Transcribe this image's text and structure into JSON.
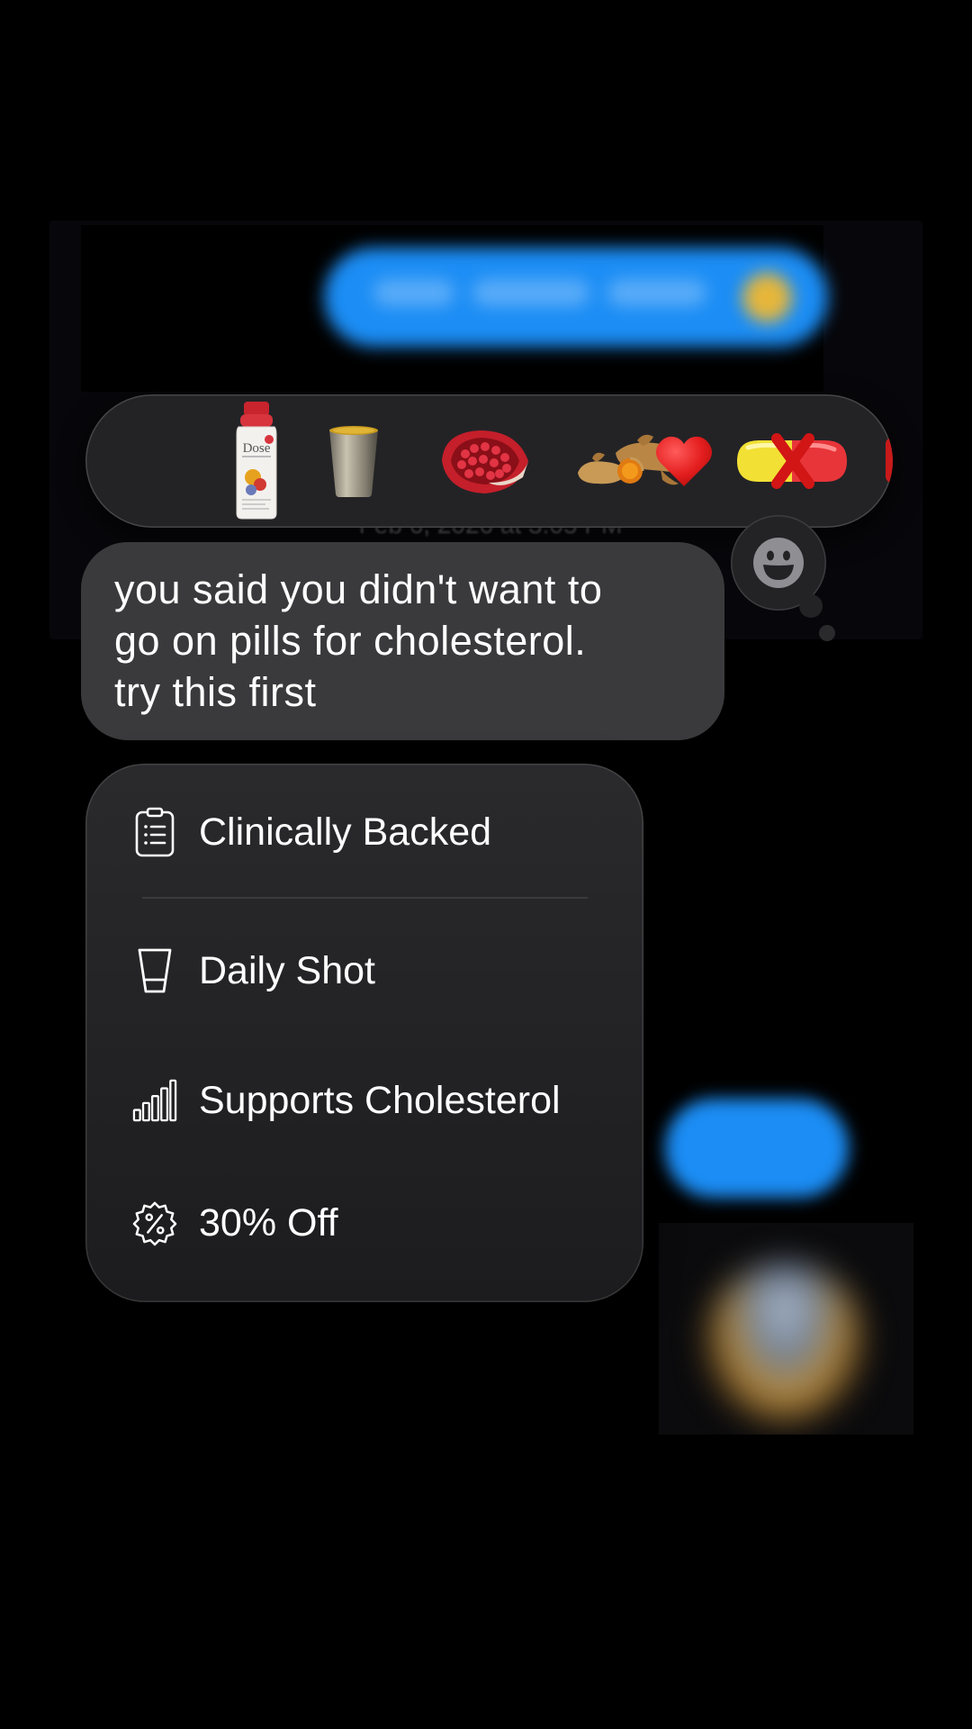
{
  "timestamp": "Feb 6, 2026 at 3:05 PM",
  "reactions": [
    {
      "name": "dose-bottle-icon",
      "brand": "Dose"
    },
    {
      "name": "shot-cup-icon"
    },
    {
      "name": "pomegranate-icon"
    },
    {
      "name": "turmeric-icon"
    },
    {
      "name": "red-heart-icon"
    },
    {
      "name": "crossed-pill-icon"
    }
  ],
  "message": {
    "text": "you said you didn't want to\ngo on pills for cholesterol.\ntry this first"
  },
  "features": [
    {
      "icon": "clipboard-list-icon",
      "label": "Clinically Backed"
    },
    {
      "icon": "shot-glass-icon",
      "label": "Daily Shot"
    },
    {
      "icon": "signal-bars-icon",
      "label": "Supports Cholesterol"
    },
    {
      "icon": "percent-badge-icon",
      "label": "30% Off"
    }
  ],
  "colors": {
    "background": "#000000",
    "imessage_blue": "#1b8df5",
    "bubble_gray": "#3a3a3c",
    "reaction_bar": "#232326",
    "heart_red": "#e41e1e"
  }
}
